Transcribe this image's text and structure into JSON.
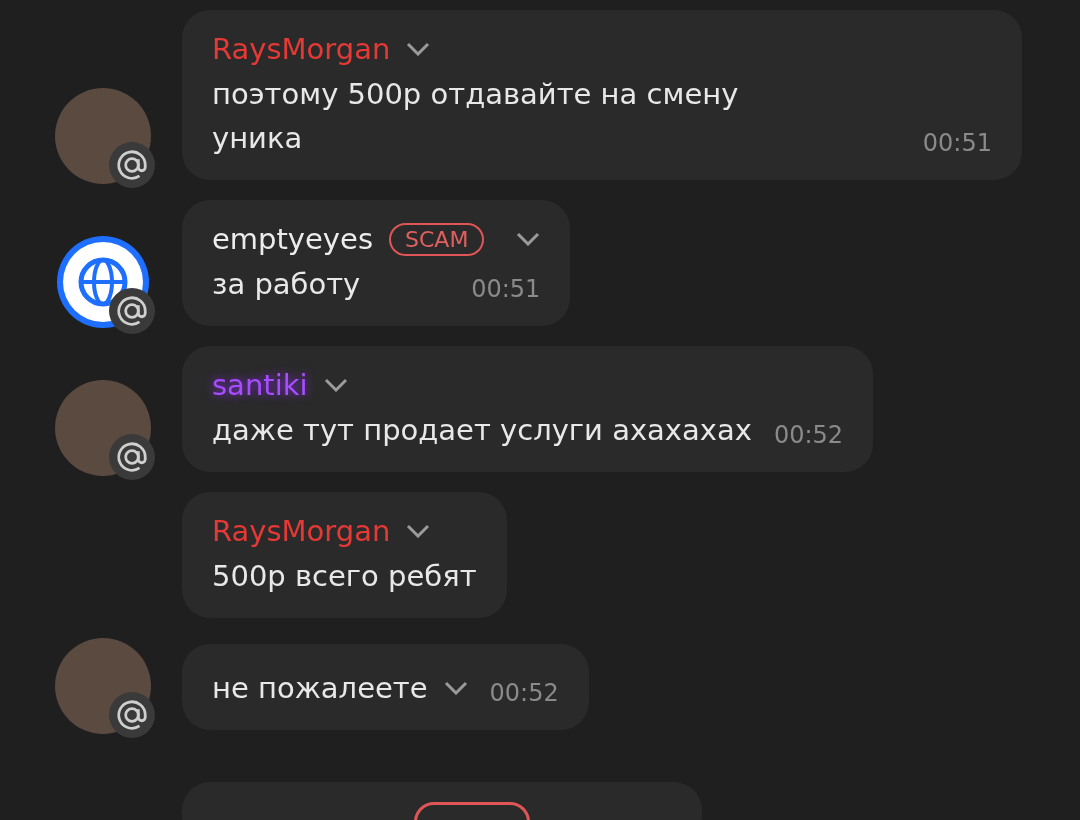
{
  "messages": [
    {
      "kind": "message",
      "avatar": {
        "kind": "photo"
      },
      "sender": {
        "name": "RaysMorgan",
        "color": "#e53935",
        "glow": false
      },
      "text": "поэтому 500р отдавайте на смену уника",
      "time": "00:51"
    },
    {
      "kind": "message",
      "avatar": {
        "kind": "globe"
      },
      "sender": {
        "name": "emptyeyes",
        "color": "#ececec",
        "glow": false,
        "badge": "SCAM"
      },
      "text": "за работу",
      "time": "00:51"
    },
    {
      "kind": "message",
      "avatar": {
        "kind": "photo"
      },
      "sender": {
        "name": "santiki",
        "color": "#a64dff",
        "glow": true
      },
      "text": "даже тут продает услуги ахахахах",
      "time": "00:52"
    },
    {
      "kind": "message",
      "sender": {
        "name": "RaysMorgan",
        "color": "#e53935",
        "glow": false
      },
      "text": "500р всего ребят"
    },
    {
      "kind": "message",
      "avatar": {
        "kind": "photo"
      },
      "text": "не пожалеете",
      "time": "00:52"
    },
    {
      "kind": "partial"
    }
  ]
}
